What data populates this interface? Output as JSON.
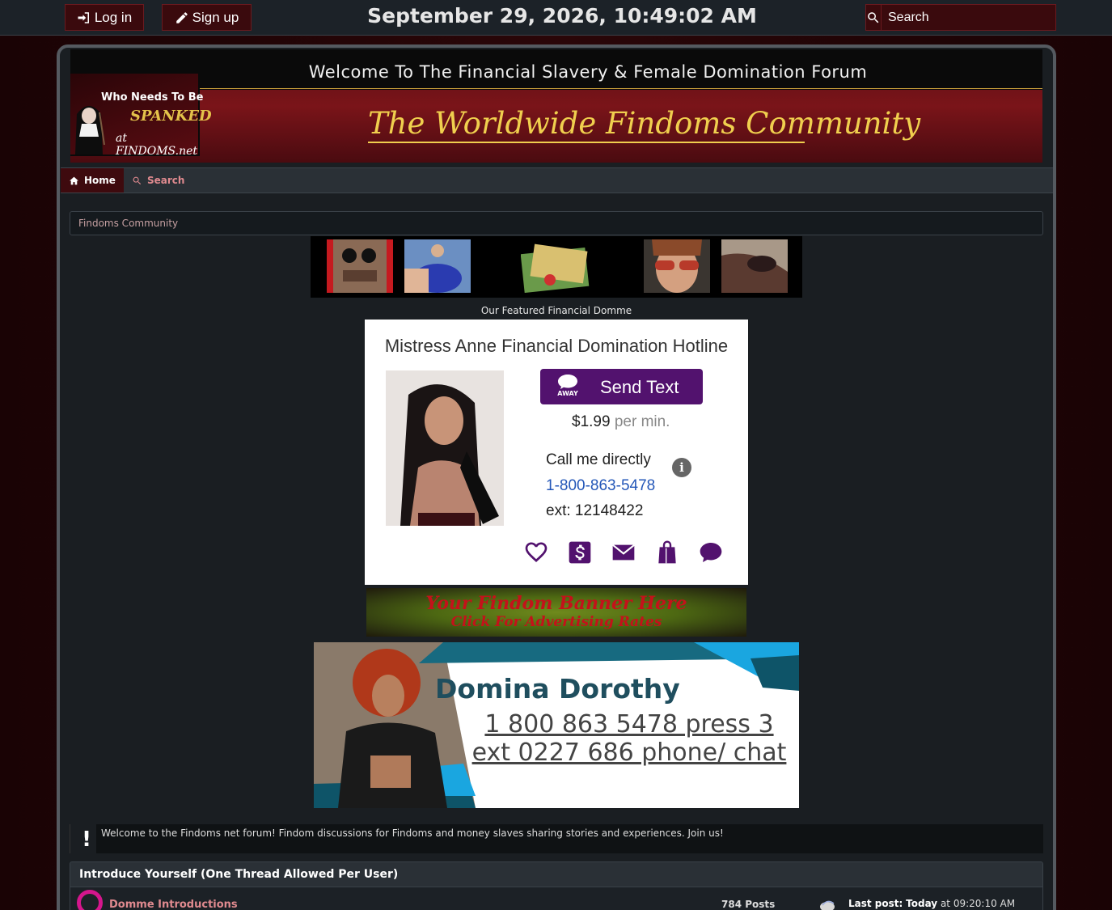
{
  "topbar": {
    "login_label": "Log in",
    "signup_label": "Sign up",
    "datetime": "September 29, 2026, 10:49:02 AM",
    "search_placeholder": "Search"
  },
  "header": {
    "welcome": "Welcome To The Financial Slavery & Female Domination Forum",
    "logo": {
      "line1": "Who Needs To Be",
      "line2": "SPANKED",
      "line3": "at FINDOMS.net"
    },
    "script_title": "The Worldwide Findoms Community"
  },
  "nav": {
    "items": [
      {
        "label": "Home",
        "icon": "home-icon",
        "active": true
      },
      {
        "label": "Search",
        "icon": "search-icon",
        "active": false
      }
    ]
  },
  "breadcrumb": "Findoms Community",
  "featured_label": "Our Featured Financial Domme",
  "ad_card": {
    "title": "Mistress Anne Financial Domination Hotline",
    "send_text": "Send Text",
    "away_label": "AWAY",
    "price": "$1.99",
    "price_unit": "per min.",
    "call_label": "Call me directly",
    "phone": "1-800-863-5478",
    "ext": "ext: 12148422",
    "icons": [
      "heart-icon",
      "dollar-icon",
      "mail-icon",
      "shopping-bag-icon",
      "chat-icon"
    ],
    "accent": "#52126e"
  },
  "banner_ad": {
    "line1": "Your Findom Banner Here",
    "line2": "Click For Advertising Rates"
  },
  "dorothy_ad": {
    "name": "Domina Dorothy",
    "number": "1 800 863 5478 press 3 ext 0227 686 phone/ chat"
  },
  "notice": {
    "text": "Welcome to the Findoms net forum! Findom discussions for Findoms and money slaves sharing stories and experiences. Join us!"
  },
  "category": {
    "title": "Introduce Yourself (One Thread Allowed Per User)",
    "boards": [
      {
        "name": "Domme Introductions",
        "posts": "784 Posts",
        "last_post_label": "Last post:",
        "last_post_day": "Today",
        "last_post_time": "at 09:20:10 AM"
      }
    ]
  },
  "colors": {
    "brand_dark_red": "#3e0a0e",
    "link_pink": "#e08a8f",
    "gold": "#f0cf4e",
    "forum_ring": "#d4168c"
  }
}
